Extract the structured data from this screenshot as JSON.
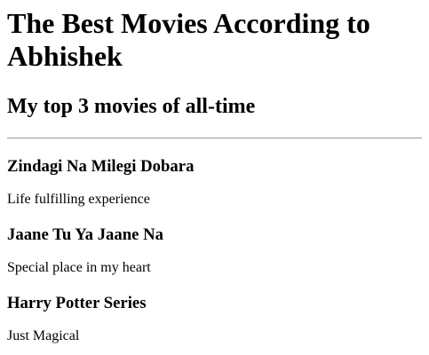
{
  "page": {
    "title": "The Best Movies According to Abhishek",
    "subtitle": "My top 3 movies of all-time"
  },
  "movies": [
    {
      "title": "Zindagi Na Milegi Dobara",
      "description": "Life fulfilling experience"
    },
    {
      "title": "Jaane Tu Ya Jaane Na",
      "description": "Special place in my heart"
    },
    {
      "title": "Harry Potter Series",
      "description": "Just Magical"
    }
  ]
}
